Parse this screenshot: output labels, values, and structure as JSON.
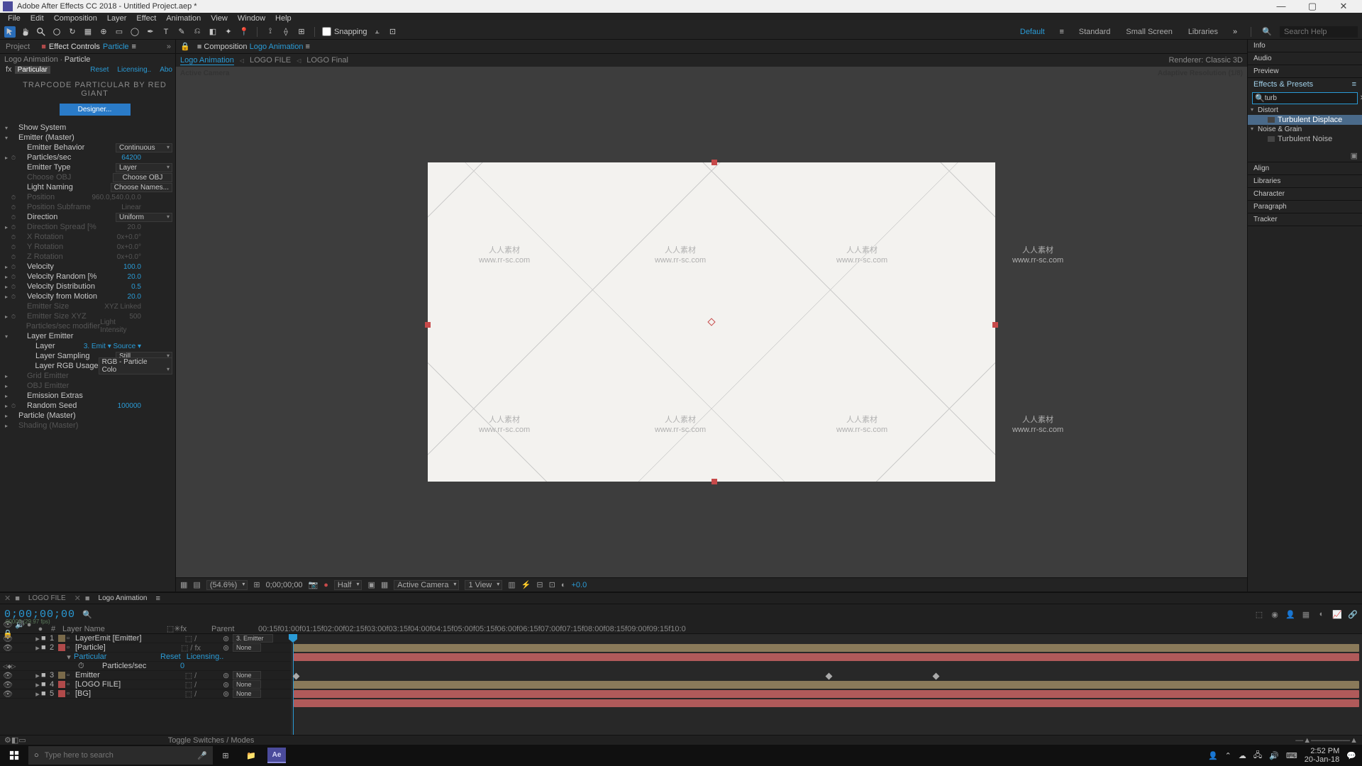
{
  "title": "Adobe After Effects CC 2018 - Untitled Project.aep *",
  "menu": [
    "File",
    "Edit",
    "Composition",
    "Layer",
    "Effect",
    "Animation",
    "View",
    "Window",
    "Help"
  ],
  "toolbar": {
    "snapping": "Snapping"
  },
  "workspaces": [
    "Default",
    "Standard",
    "Small Screen",
    "Libraries"
  ],
  "search_help": "Search Help",
  "left": {
    "project_tab": "Project",
    "fx_tab_prefix": "Effect Controls",
    "fx_tab_name": "Particle",
    "crumb_comp": "Logo Animation",
    "crumb_layer": "Particle",
    "effect_name": "Particular",
    "reset": "Reset",
    "licensing": "Licensing..",
    "about": "Abo",
    "banner": "TRAPCODE PARTICULAR BY RED GIANT",
    "designer": "Designer...",
    "props": [
      {
        "ind": 0,
        "tw": "open",
        "lbl": "Show System",
        "val": ""
      },
      {
        "ind": 0,
        "tw": "open",
        "lbl": "Emitter (Master)",
        "val": ""
      },
      {
        "ind": 1,
        "lbl": "Emitter Behavior",
        "val": "Continuous",
        "dd": true
      },
      {
        "ind": 1,
        "tw": "o",
        "sw": true,
        "lbl": "Particles/sec",
        "val": "64200"
      },
      {
        "ind": 1,
        "lbl": "Emitter Type",
        "val": "Layer",
        "dd": true
      },
      {
        "ind": 1,
        "lbl": "Choose OBJ",
        "val": "Choose OBJ",
        "dim": true,
        "btn": true
      },
      {
        "ind": 1,
        "lbl": "Light Naming",
        "val": "Choose Names...",
        "btn": true
      },
      {
        "ind": 1,
        "sw": true,
        "lbl": "Position",
        "val": "960.0,540.0,0.0",
        "dim": true
      },
      {
        "ind": 1,
        "sw": true,
        "lbl": "Position Subframe",
        "val": "Linear",
        "dim": true
      },
      {
        "ind": 1,
        "sw": true,
        "lbl": "Direction",
        "val": "Uniform",
        "dd": true
      },
      {
        "ind": 1,
        "tw": "o",
        "sw": true,
        "lbl": "Direction Spread [%",
        "val": "20.0",
        "dim": true
      },
      {
        "ind": 1,
        "sw": true,
        "lbl": "X Rotation",
        "val": "0x+0.0°",
        "dim": true
      },
      {
        "ind": 1,
        "sw": true,
        "lbl": "Y Rotation",
        "val": "0x+0.0°",
        "dim": true
      },
      {
        "ind": 1,
        "sw": true,
        "lbl": "Z Rotation",
        "val": "0x+0.0°",
        "dim": true
      },
      {
        "ind": 1,
        "tw": "o",
        "sw": true,
        "lbl": "Velocity",
        "val": "100.0"
      },
      {
        "ind": 1,
        "tw": "o",
        "sw": true,
        "lbl": "Velocity Random [%",
        "val": "20.0"
      },
      {
        "ind": 1,
        "tw": "o",
        "sw": true,
        "lbl": "Velocity Distribution",
        "val": "0.5"
      },
      {
        "ind": 1,
        "tw": "o",
        "sw": true,
        "lbl": "Velocity from Motion",
        "val": "20.0"
      },
      {
        "ind": 1,
        "lbl": "Emitter Size",
        "val": "XYZ Linked",
        "dim": true
      },
      {
        "ind": 1,
        "tw": "o",
        "sw": true,
        "lbl": "Emitter Size XYZ",
        "val": "500",
        "dim": true
      },
      {
        "ind": 1,
        "lbl": "Particles/sec modifier",
        "val": "Light Intensity",
        "dim": true
      },
      {
        "ind": 1,
        "tw": "open",
        "lbl": "Layer Emitter",
        "val": ""
      },
      {
        "ind": 2,
        "lbl": "Layer",
        "val": "3. Emit ▾   Source ▾"
      },
      {
        "ind": 2,
        "lbl": "Layer Sampling",
        "val": "Still",
        "dd": true
      },
      {
        "ind": 2,
        "lbl": "Layer RGB Usage",
        "val": "RGB - Particle Colo",
        "dd": true
      },
      {
        "ind": 1,
        "tw": "o",
        "lbl": "Grid Emitter",
        "val": "",
        "dim": true
      },
      {
        "ind": 1,
        "tw": "o",
        "lbl": "OBJ Emitter",
        "val": "",
        "dim": true
      },
      {
        "ind": 1,
        "tw": "o",
        "lbl": "Emission Extras",
        "val": ""
      },
      {
        "ind": 1,
        "tw": "o",
        "sw": true,
        "lbl": "Random Seed",
        "val": "100000"
      },
      {
        "ind": 0,
        "tw": "o",
        "lbl": "Particle (Master)",
        "val": ""
      },
      {
        "ind": 0,
        "tw": "o",
        "lbl": "Shading (Master)",
        "val": "",
        "dim": true
      }
    ]
  },
  "center": {
    "comp_label": "Composition",
    "comp_name": "Logo Animation",
    "crumbs": [
      "Logo Animation",
      "LOGO FILE",
      "LOGO Final"
    ],
    "renderer_label": "Renderer:",
    "renderer_value": "Classic 3D",
    "active_camera": "Active Camera",
    "adaptive": "Adaptive Resolution (1/8)",
    "wm_cn": "人人素材",
    "wm_url": "www.rr-sc.com",
    "status": {
      "mag": "(54.6%)",
      "tc": "0;00;00;00",
      "res": "Half",
      "cam": "Active Camera",
      "view": "1 View",
      "exp": "+0.0"
    }
  },
  "right": {
    "panels": [
      "Info",
      "Audio",
      "Preview",
      "Effects & Presets"
    ],
    "search_value": "turb",
    "cat1": "Distort",
    "item1": "Turbulent Displace",
    "cat2": "Noise & Grain",
    "item2": "Turbulent Noise",
    "panels2": [
      "Align",
      "Libraries",
      "Character",
      "Paragraph",
      "Tracker"
    ]
  },
  "timeline": {
    "tabs": [
      "LOGO FILE",
      "Logo Animation"
    ],
    "tc": "0;00;00;00",
    "tc_sub": "00000 (29.97 fps)",
    "hdr": {
      "num": "#",
      "name": "Layer Name",
      "sw": "⬚✳fx",
      "parent": "Parent"
    },
    "layers": [
      {
        "n": "1",
        "col": "#7a6a4a",
        "name": "LayerEmit [Emitter]",
        "parent": "3. Emitter"
      },
      {
        "n": "2",
        "col": "#b04a4a",
        "name": "[Particle]",
        "sel": true,
        "parent": "None",
        "fx": true
      },
      {
        "effect": true,
        "name": "Particular",
        "reset": "Reset",
        "lic": "Licensing.."
      },
      {
        "prop": true,
        "name": "Particles/sec",
        "val": "0"
      },
      {
        "n": "3",
        "col": "#7a6a4a",
        "name": "Emitter",
        "parent": "None"
      },
      {
        "n": "4",
        "col": "#b04a4a",
        "name": "[LOGO FILE]",
        "parent": "None"
      },
      {
        "n": "5",
        "col": "#b04a4a",
        "name": "[BG]",
        "parent": "None"
      }
    ],
    "ticks": [
      "00:15f",
      "01:00f",
      "01:15f",
      "02:00f",
      "02:15f",
      "03:00f",
      "03:15f",
      "04:00f",
      "04:15f",
      "05:00f",
      "05:15f",
      "06:00f",
      "06:15f",
      "07:00f",
      "07:15f",
      "08:00f",
      "08:15f",
      "09:00f",
      "09:15f",
      "10:0"
    ],
    "toggle": "Toggle Switches / Modes"
  },
  "taskbar": {
    "search": "Type here to search",
    "time": "2:52 PM",
    "date": "20-Jan-18"
  }
}
